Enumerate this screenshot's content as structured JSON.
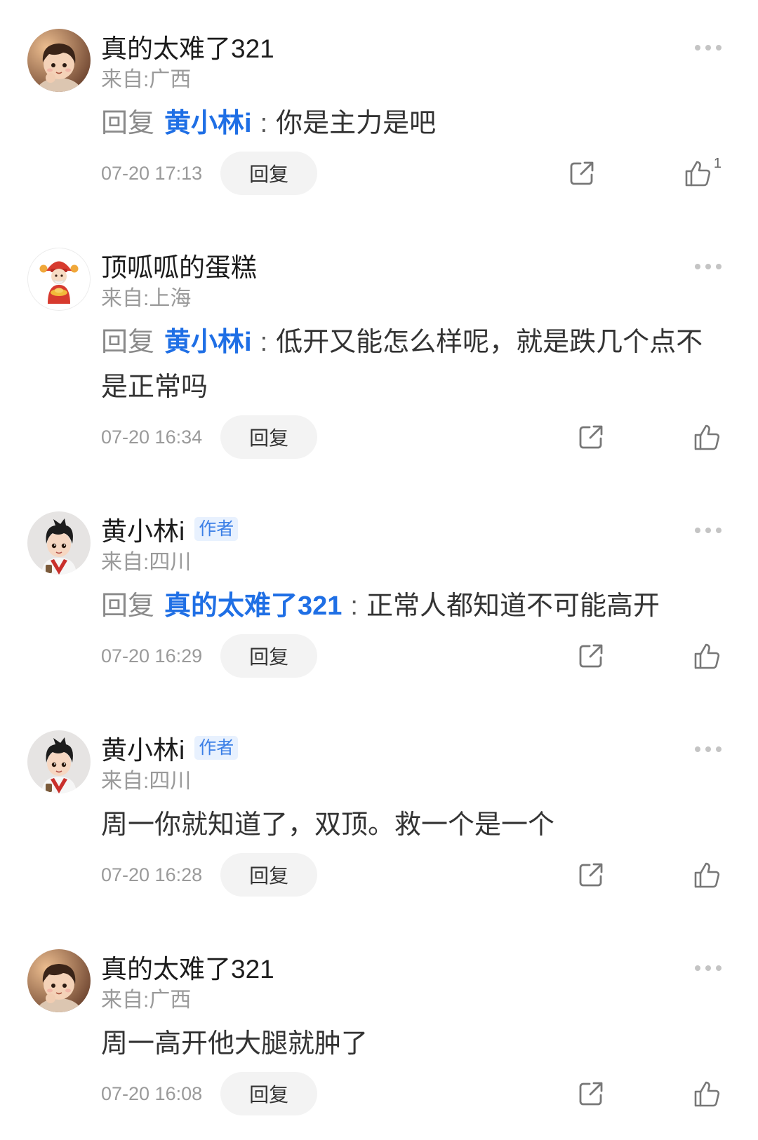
{
  "comments": [
    {
      "name": "真的太难了321",
      "location": "来自:广西",
      "reply_prefix": "回复",
      "reply_to": "黄小林i",
      "separator": ":",
      "body": "你是主力是吧",
      "time": "07-20 17:13",
      "reply_button": "回复",
      "like_count": "1",
      "avatar": "cartoon-boy-warm-avatar"
    },
    {
      "name": "顶呱呱的蛋糕",
      "location": "来自:上海",
      "reply_prefix": "回复",
      "reply_to": "黄小林i",
      "separator": ":",
      "body": "低开又能怎么样呢，就是跌几个点不是正常吗",
      "time": "07-20 16:34",
      "reply_button": "回复",
      "avatar": "fortune-god-avatar"
    },
    {
      "name": "黄小林i",
      "badge": "作者",
      "location": "来自:四川",
      "reply_prefix": "回复",
      "reply_to": "真的太难了321",
      "separator": ":",
      "body": "正常人都知道不可能高开",
      "time": "07-20 16:29",
      "reply_button": "回复",
      "avatar": "cartoon-boy-spiky-avatar"
    },
    {
      "name": "黄小林i",
      "badge": "作者",
      "location": "来自:四川",
      "body": "周一你就知道了，双顶。救一个是一个",
      "time": "07-20 16:28",
      "reply_button": "回复",
      "avatar": "cartoon-boy-spiky-avatar"
    },
    {
      "name": "真的太难了321",
      "location": "来自:广西",
      "body": "周一高开他大腿就肿了",
      "time": "07-20 16:08",
      "reply_button": "回复",
      "avatar": "cartoon-boy-warm-avatar"
    }
  ],
  "icons": {
    "more": "more-dots-icon",
    "share": "share-icon",
    "like": "thumbs-up-icon"
  },
  "colors": {
    "mention_link": "#1f6fe5",
    "badge_text": "#3b7fe6",
    "badge_bg": "#e8f1fe",
    "meta_text": "#9a9a9a",
    "body_text": "#333333",
    "reply_button_bg": "#f3f3f3"
  }
}
